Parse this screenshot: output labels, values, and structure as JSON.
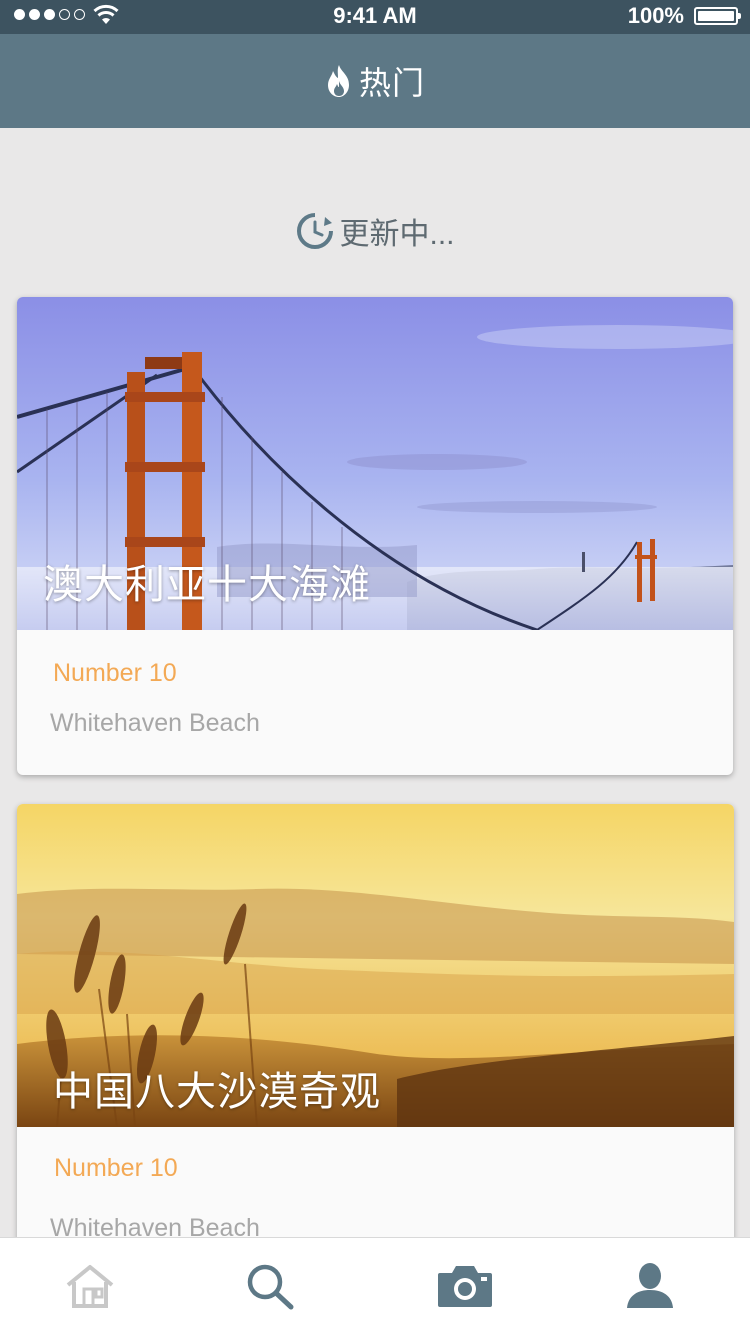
{
  "status_bar": {
    "time": "9:41 AM",
    "battery_text": "100%",
    "battery_level": 1.0,
    "signal_bars_filled": 3,
    "signal_bars_total": 5
  },
  "navbar": {
    "title": "热门",
    "icon": "flame-icon"
  },
  "refresh": {
    "label": "更新中...",
    "icon": "refresh-clock-icon"
  },
  "cards": [
    {
      "title": "澳大利亚十大海滩",
      "subtitle": "Number 10",
      "caption": "Whitehaven Beach",
      "image": "golden-gate-bridge"
    },
    {
      "title": "中国八大沙漠奇观",
      "subtitle": "Number 10",
      "caption": "Whitehaven Beach",
      "image": "desert-sunset-hills"
    }
  ],
  "tabs": [
    {
      "icon": "home-icon",
      "active": false
    },
    {
      "icon": "search-icon",
      "active": true
    },
    {
      "icon": "camera-icon",
      "active": false
    },
    {
      "icon": "profile-icon",
      "active": false
    }
  ],
  "colors": {
    "navbar": "#5d7886",
    "status_bar": "#3d5360",
    "accent_orange": "#f3a955",
    "caption_gray": "#a7a7a7",
    "tab_active": "#5d7886",
    "tab_inactive": "#c8c8c8"
  }
}
